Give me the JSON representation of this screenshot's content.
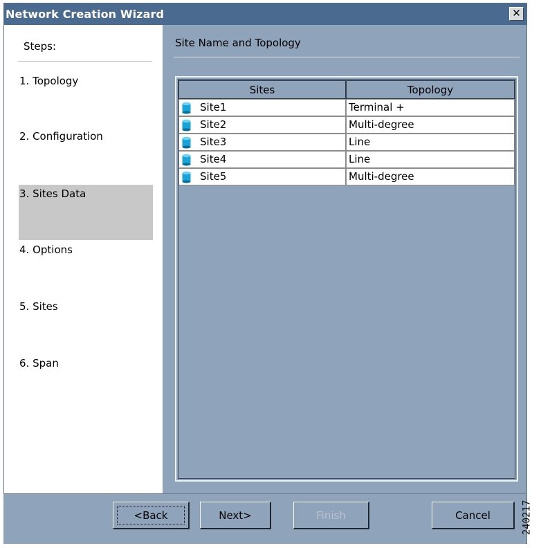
{
  "window": {
    "title": "Network Creation Wizard",
    "close_glyph": "✕"
  },
  "steps": {
    "header": "Steps:",
    "items": [
      "1. Topology",
      "2. Configuration",
      "3. Sites Data",
      "4. Options",
      "5. Sites",
      "6. Span"
    ],
    "selected_index": 2
  },
  "content": {
    "header": "Site Name and Topology",
    "columns": [
      "Sites",
      "Topology"
    ],
    "rows": [
      {
        "site": "Site1",
        "topology": "Terminal +"
      },
      {
        "site": "Site2",
        "topology": "Multi-degree"
      },
      {
        "site": "Site3",
        "topology": "Line"
      },
      {
        "site": "Site4",
        "topology": "Line"
      },
      {
        "site": "Site5",
        "topology": "Multi-degree"
      }
    ],
    "row_icon": "site-node-icon"
  },
  "buttons": {
    "back": "<Back",
    "next": "Next>",
    "finish": "Finish",
    "cancel": "Cancel",
    "finish_enabled": false
  },
  "side_label": "240217",
  "colors": {
    "titlebar": "#4b6a8f",
    "panel": "#8fa3bb",
    "selected_step": "#c8c8c8",
    "icon": "#1aa3d6"
  }
}
